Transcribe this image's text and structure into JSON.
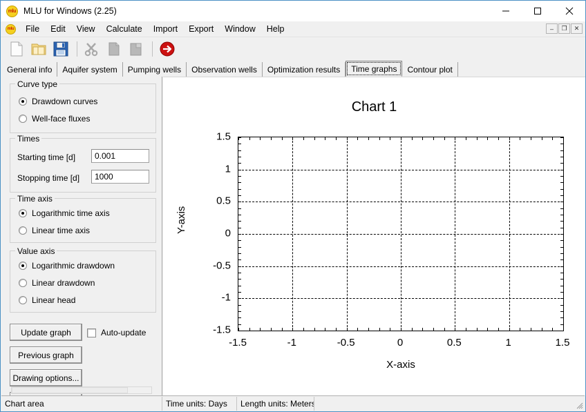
{
  "window": {
    "title": "MLU for Windows (2.25)",
    "app_icon": "mlu",
    "controls": {
      "minimize": "minimize-icon",
      "maximize": "maximize-icon",
      "close": "close-icon"
    }
  },
  "menubar": {
    "icon": "mlu",
    "items": [
      "File",
      "Edit",
      "View",
      "Calculate",
      "Import",
      "Export",
      "Window",
      "Help"
    ],
    "mdi_controls": {
      "minimize": "–",
      "restore": "❐",
      "close": "✕"
    }
  },
  "toolbar": {
    "buttons": [
      {
        "name": "new-document-icon",
        "label": "New"
      },
      {
        "name": "open-folder-icon",
        "label": "Open"
      },
      {
        "name": "save-floppy-icon",
        "label": "Save"
      },
      {
        "name": "cut-scissors-icon",
        "label": "Cut"
      },
      {
        "name": "copy-icon",
        "label": "Copy"
      },
      {
        "name": "paste-icon",
        "label": "Paste"
      },
      {
        "name": "run-arrow-icon",
        "label": "Run"
      }
    ]
  },
  "tabs": {
    "items": [
      "General info",
      "Aquifer system",
      "Pumping wells",
      "Observation wells",
      "Optimization results",
      "Time graphs",
      "Contour plot"
    ],
    "selected_index": 5
  },
  "panel": {
    "curve_type": {
      "title": "Curve type",
      "options": [
        "Drawdown curves",
        "Well-face fluxes"
      ],
      "selected_index": 0
    },
    "times": {
      "title": "Times",
      "starting_label": "Starting time [d]",
      "starting_value": "0.001",
      "stopping_label": "Stopping time [d]",
      "stopping_value": "1000"
    },
    "time_axis": {
      "title": "Time axis",
      "options": [
        "Logarithmic time axis",
        "Linear time axis"
      ],
      "selected_index": 0
    },
    "value_axis": {
      "title": "Value axis",
      "options": [
        "Logarithmic drawdown",
        "Linear drawdown",
        "Linear head"
      ],
      "selected_index": 0
    },
    "update_graph_label": "Update graph",
    "auto_update_label": "Auto-update",
    "auto_update_checked": false,
    "previous_graph_label": "Previous graph",
    "drawing_options_label": "Drawing options..."
  },
  "chart_data": {
    "type": "line",
    "title": "Chart 1",
    "xlabel": "X-axis",
    "ylabel": "Y-axis",
    "xlim": [
      -1.5,
      1.5
    ],
    "ylim": [
      -1.5,
      1.5
    ],
    "xticks": [
      -1.5,
      -1,
      -0.5,
      0,
      0.5,
      1,
      1.5
    ],
    "xtick_labels": [
      "-1.5",
      "-1",
      "-0.5",
      "0",
      "0.5",
      "1",
      "1.5"
    ],
    "yticks": [
      -1.5,
      -1,
      -0.5,
      0,
      0.5,
      1,
      1.5
    ],
    "ytick_labels": [
      "-1.5",
      "-1",
      "-0.5",
      "0",
      "0.5",
      "1",
      "1.5"
    ],
    "minor_ticks_per_major": 5,
    "grid": true,
    "grid_style": "dashed",
    "legend": null,
    "series": []
  },
  "statusbar": {
    "cells": [
      "Chart area",
      "Time units: Days",
      "Length units: Meters"
    ]
  }
}
